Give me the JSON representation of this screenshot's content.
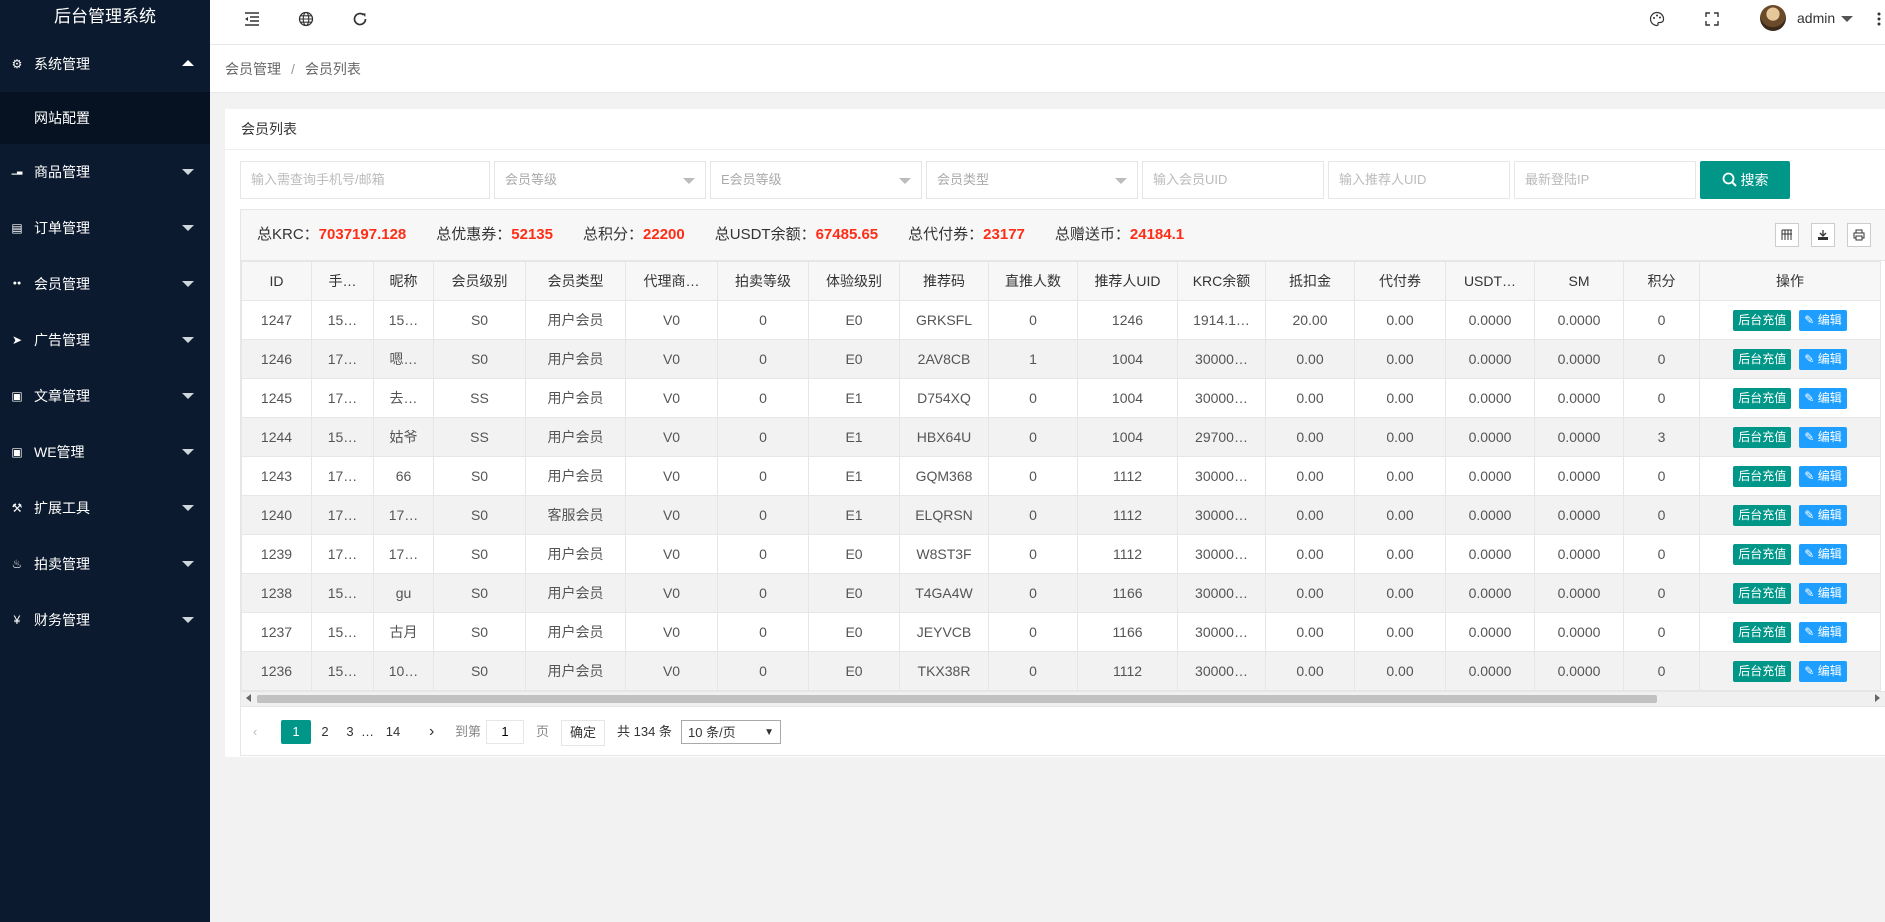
{
  "app": {
    "title": "后台管理系统",
    "user": "admin"
  },
  "sidebar": {
    "items": [
      {
        "label": "系统管理",
        "icon": "gear-icon",
        "expanded": true,
        "children": [
          {
            "label": "网站配置"
          }
        ]
      },
      {
        "label": "商品管理",
        "icon": "chart-icon"
      },
      {
        "label": "订单管理",
        "icon": "calendar-icon"
      },
      {
        "label": "会员管理",
        "icon": "users-icon"
      },
      {
        "label": "广告管理",
        "icon": "rocket-icon"
      },
      {
        "label": "文章管理",
        "icon": "copy-icon"
      },
      {
        "label": "WE管理",
        "icon": "copy-icon"
      },
      {
        "label": "扩展工具",
        "icon": "wrench-icon"
      },
      {
        "label": "拍卖管理",
        "icon": "fire-icon"
      },
      {
        "label": "财务管理",
        "icon": "yen-icon"
      }
    ]
  },
  "breadcrumb": {
    "parent": "会员管理",
    "sep": "/",
    "current": "会员列表"
  },
  "card": {
    "title": "会员列表"
  },
  "search": {
    "phone_placeholder": "输入需查询手机号/邮箱",
    "level_placeholder": "会员等级",
    "e_level_placeholder": "E会员等级",
    "type_placeholder": "会员类型",
    "uid_placeholder": "输入会员UID",
    "ref_uid_placeholder": "输入推荐人UID",
    "ip_placeholder": "最新登陆IP",
    "button": "搜索"
  },
  "totals": [
    {
      "label": "总KRC：",
      "value": "7037197.128"
    },
    {
      "label": "总优惠券：",
      "value": "52135"
    },
    {
      "label": "总积分：",
      "value": "22200"
    },
    {
      "label": "总USDT余额：",
      "value": "67485.65"
    },
    {
      "label": "总代付券：",
      "value": "23177"
    },
    {
      "label": "总赠送币：",
      "value": "24184.1"
    }
  ],
  "table": {
    "headers": [
      "ID",
      "手…",
      "昵称",
      "会员级别",
      "会员类型",
      "代理商…",
      "拍卖等级",
      "体验级别",
      "推荐码",
      "直推人数",
      "推荐人UID",
      "KRC余额",
      "抵扣金",
      "代付券",
      "USDT…",
      "SM",
      "积分",
      "操作"
    ],
    "ops": {
      "recharge": "后台充值",
      "edit": "编辑"
    },
    "rows": [
      [
        "1247",
        "15…",
        "15…",
        "S0",
        "用户会员",
        "V0",
        "0",
        "E0",
        "GRKSFL",
        "0",
        "1246",
        "1914.1…",
        "20.00",
        "0.00",
        "0.0000",
        "0.0000",
        "0"
      ],
      [
        "1246",
        "17…",
        "嗯…",
        "S0",
        "用户会员",
        "V0",
        "0",
        "E0",
        "2AV8CB",
        "1",
        "1004",
        "30000…",
        "0.00",
        "0.00",
        "0.0000",
        "0.0000",
        "0"
      ],
      [
        "1245",
        "17…",
        "去…",
        "SS",
        "用户会员",
        "V0",
        "0",
        "E1",
        "D754XQ",
        "0",
        "1004",
        "30000…",
        "0.00",
        "0.00",
        "0.0000",
        "0.0000",
        "0"
      ],
      [
        "1244",
        "15…",
        "姑爷",
        "SS",
        "用户会员",
        "V0",
        "0",
        "E1",
        "HBX64U",
        "0",
        "1004",
        "29700…",
        "0.00",
        "0.00",
        "0.0000",
        "0.0000",
        "3"
      ],
      [
        "1243",
        "17…",
        "66",
        "S0",
        "用户会员",
        "V0",
        "0",
        "E1",
        "GQM368",
        "0",
        "1112",
        "30000…",
        "0.00",
        "0.00",
        "0.0000",
        "0.0000",
        "0"
      ],
      [
        "1240",
        "17…",
        "17…",
        "S0",
        "客服会员",
        "V0",
        "0",
        "E1",
        "ELQRSN",
        "0",
        "1112",
        "30000…",
        "0.00",
        "0.00",
        "0.0000",
        "0.0000",
        "0"
      ],
      [
        "1239",
        "17…",
        "17…",
        "S0",
        "用户会员",
        "V0",
        "0",
        "E0",
        "W8ST3F",
        "0",
        "1112",
        "30000…",
        "0.00",
        "0.00",
        "0.0000",
        "0.0000",
        "0"
      ],
      [
        "1238",
        "15…",
        "gu",
        "S0",
        "用户会员",
        "V0",
        "0",
        "E0",
        "T4GA4W",
        "0",
        "1166",
        "30000…",
        "0.00",
        "0.00",
        "0.0000",
        "0.0000",
        "0"
      ],
      [
        "1237",
        "15…",
        "古月",
        "S0",
        "用户会员",
        "V0",
        "0",
        "E0",
        "JEYVCB",
        "0",
        "1166",
        "30000…",
        "0.00",
        "0.00",
        "0.0000",
        "0.0000",
        "0"
      ],
      [
        "1236",
        "15…",
        "10…",
        "S0",
        "用户会员",
        "V0",
        "0",
        "E0",
        "TKX38R",
        "0",
        "1112",
        "30000…",
        "0.00",
        "0.00",
        "0.0000",
        "0.0000",
        "0"
      ]
    ]
  },
  "pager": {
    "pages": [
      "1",
      "2",
      "3",
      "…",
      "14"
    ],
    "current": "1",
    "goto_label": "到第",
    "goto_value": "1",
    "page_unit": "页",
    "confirm": "确定",
    "total": "共 134 条",
    "page_size": "10 条/页"
  }
}
